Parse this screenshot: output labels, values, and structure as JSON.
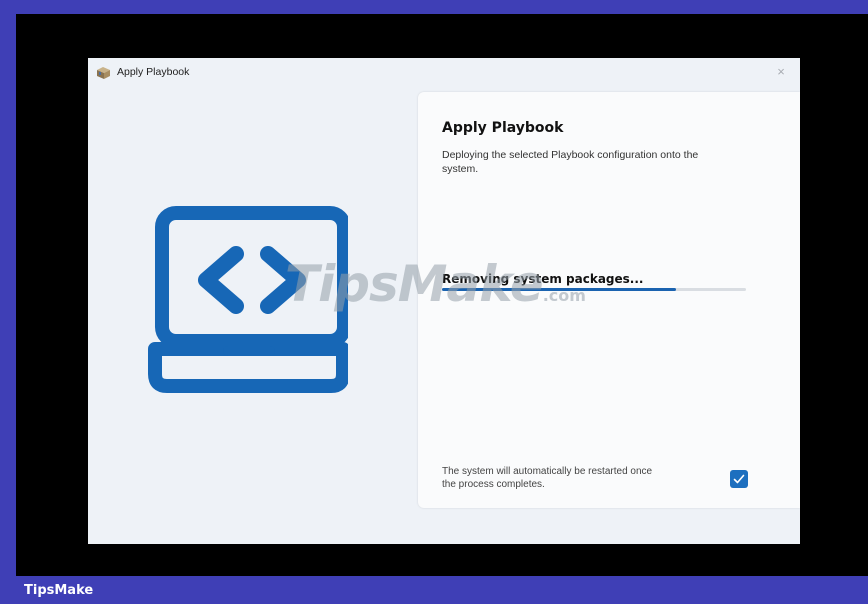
{
  "window": {
    "title": "Apply Playbook",
    "close_glyph": "×"
  },
  "panel": {
    "heading": "Apply Playbook",
    "description": "Deploying the selected Playbook configuration onto the system.",
    "status_text": "Removing system packages...",
    "progress": 0.77,
    "restart_note": "The system will automatically be restarted once the process completes.",
    "restart_checked": true
  },
  "watermark": {
    "text": "TipsMake",
    "suffix": ".com"
  },
  "footer": {
    "label": "TipsMake"
  },
  "colors": {
    "accent": "#1d6fbf",
    "progress": "#1a63b0",
    "frame": "#3f3fb6"
  },
  "icons": {
    "app": "package-box-icon",
    "illustration": "laptop-code-icon",
    "check": "checkmark-icon"
  }
}
